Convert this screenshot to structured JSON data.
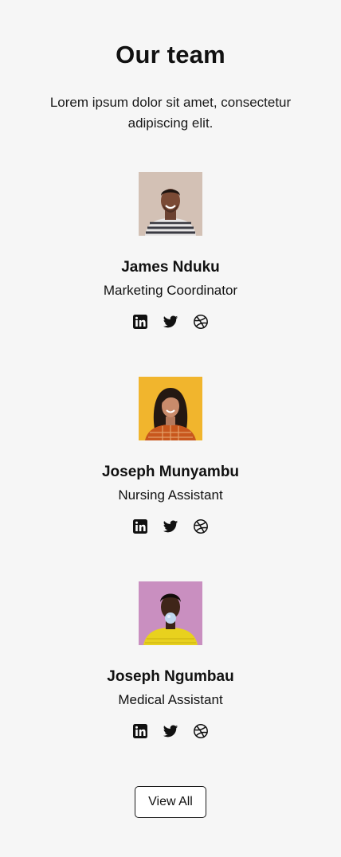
{
  "header": {
    "title": "Our team",
    "subtitle": "Lorem ipsum dolor sit amet, consectetur adipiscing elit."
  },
  "members": [
    {
      "name": "James Nduku",
      "role": "Marketing Coordinator",
      "photo_background": "#d8c7bb",
      "socials": [
        "linkedin-icon",
        "twitter-icon",
        "dribbble-icon"
      ]
    },
    {
      "name": "Joseph Munyambu",
      "role": "Nursing Assistant",
      "photo_background": "#f1b52d",
      "socials": [
        "linkedin-icon",
        "twitter-icon",
        "dribbble-icon"
      ]
    },
    {
      "name": "Joseph Ngumbau",
      "role": "Medical Assistant",
      "photo_background": "#c98fc0",
      "socials": [
        "linkedin-icon",
        "twitter-icon",
        "dribbble-icon"
      ]
    }
  ],
  "footer": {
    "view_all_label": "View All"
  },
  "colors": {
    "background": "#f6f6f6",
    "text": "#111111",
    "button_border": "#1a1a1a"
  }
}
